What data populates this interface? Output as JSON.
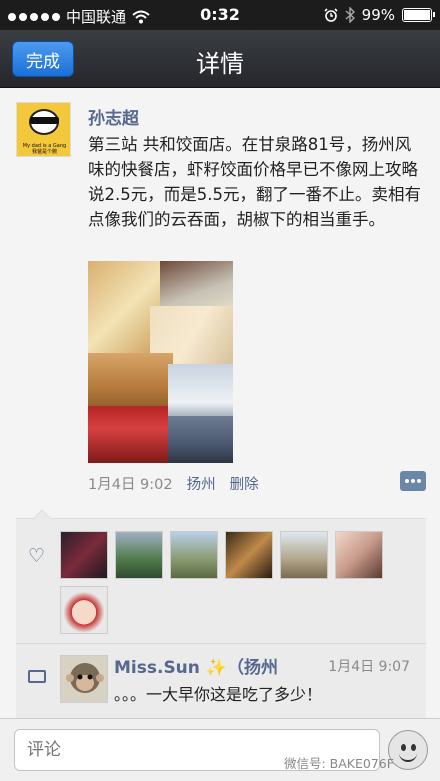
{
  "status_bar": {
    "carrier": "中国联通",
    "time": "0:32",
    "battery": "99%",
    "battery_level": 0.99
  },
  "nav": {
    "done_label": "完成",
    "title": "详情"
  },
  "post": {
    "author": "孙志超",
    "avatar_caption": "My dad is a Gang",
    "avatar_caption_2": "我爸是个腕",
    "text": "第三站 共和饺面店。在甘泉路81号，扬州风味的快餐店，虾籽饺面价格早已不像网上攻略说2.5元，而是5.5元，翻了一番不止。卖相有点像我们的云吞面，胡椒下的相当重手。",
    "date": "1月4日 9:02",
    "location": "扬州",
    "delete_label": "删除"
  },
  "comment": {
    "author": "Miss.Sun ✨（扬州",
    "time": "1月4日 9:07",
    "text": "。。。一大早你这是吃了多少！"
  },
  "bottom": {
    "input_placeholder": "评论",
    "watermark": "微信号: BAKE076F"
  },
  "colors": {
    "link": "#56688f",
    "nav_bg": "#2c2e32",
    "done_button": "#2f80e4"
  }
}
